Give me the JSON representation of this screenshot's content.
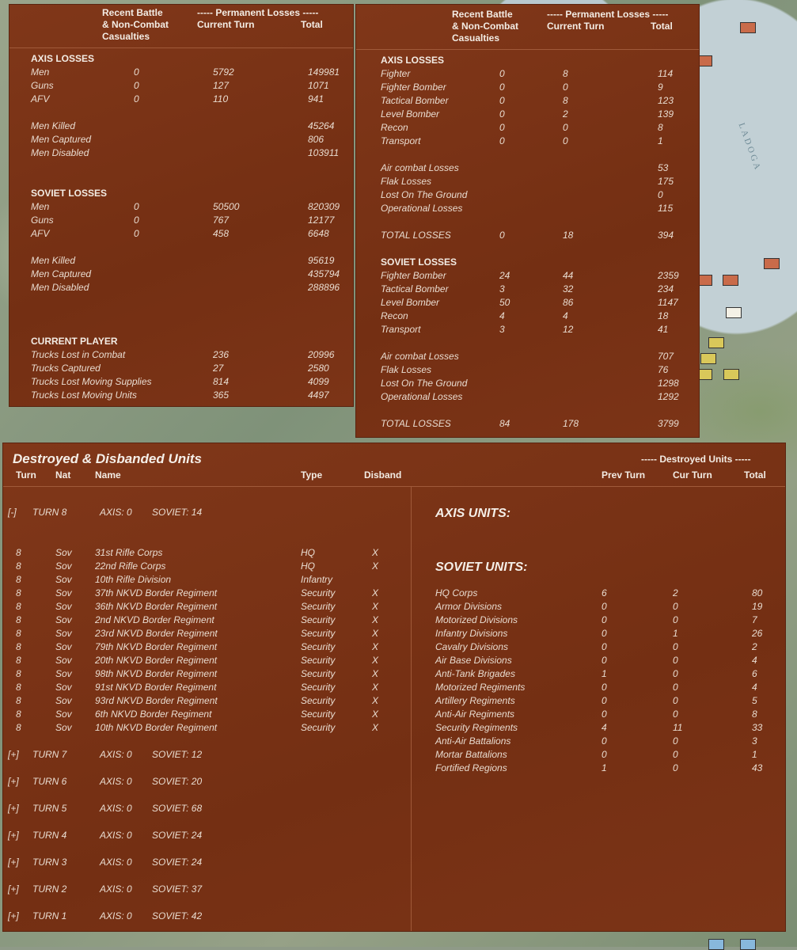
{
  "map": {
    "lake_label": "LADOGA"
  },
  "left_panel": {
    "header": {
      "recent": "Recent Battle\n& Non-Combat\nCasualties",
      "perm": "----- Permanent Losses -----",
      "current": "Current Turn",
      "total": "Total"
    },
    "sections": [
      {
        "title": "AXIS LOSSES",
        "rows": [
          [
            "Men",
            "0",
            "5792",
            "149981"
          ],
          [
            "Guns",
            "0",
            "127",
            "1071"
          ],
          [
            "AFV",
            "0",
            "110",
            "941"
          ]
        ],
        "rows2": [
          [
            "Men Killed",
            "",
            "",
            "45264"
          ],
          [
            "Men Captured",
            "",
            "",
            "806"
          ],
          [
            "Men Disabled",
            "",
            "",
            "103911"
          ]
        ]
      },
      {
        "title": "SOVIET LOSSES",
        "rows": [
          [
            "Men",
            "0",
            "50500",
            "820309"
          ],
          [
            "Guns",
            "0",
            "767",
            "12177"
          ],
          [
            "AFV",
            "0",
            "458",
            "6648"
          ]
        ],
        "rows2": [
          [
            "Men Killed",
            "",
            "",
            "95619"
          ],
          [
            "Men Captured",
            "",
            "",
            "435794"
          ],
          [
            "Men Disabled",
            "",
            "",
            "288896"
          ]
        ]
      },
      {
        "title": "CURRENT PLAYER",
        "rows": [
          [
            "Trucks Lost in Combat",
            "",
            "236",
            "20996"
          ],
          [
            "Trucks Captured",
            "",
            "27",
            "2580"
          ],
          [
            "Trucks Lost Moving Supplies",
            "",
            "814",
            "4099"
          ],
          [
            "Trucks Lost Moving Units",
            "",
            "365",
            "4497"
          ]
        ],
        "rows2": []
      }
    ]
  },
  "right_panel": {
    "header": {
      "recent": "Recent Battle\n& Non-Combat\nCasualties",
      "perm": "----- Permanent Losses -----",
      "current": "Current Turn",
      "total": "Total"
    },
    "axis_title": "AXIS LOSSES",
    "axis_rows": [
      [
        "Fighter",
        "0",
        "8",
        "114"
      ],
      [
        "Fighter Bomber",
        "0",
        "0",
        "9"
      ],
      [
        "Tactical Bomber",
        "0",
        "8",
        "123"
      ],
      [
        "Level Bomber",
        "0",
        "2",
        "139"
      ],
      [
        "Recon",
        "0",
        "0",
        "8"
      ],
      [
        "Transport",
        "0",
        "0",
        "1"
      ]
    ],
    "axis_rows2": [
      [
        "Air combat Losses",
        "",
        "",
        "53"
      ],
      [
        "Flak Losses",
        "",
        "",
        "175"
      ],
      [
        "Lost On The Ground",
        "",
        "",
        "0"
      ],
      [
        "Operational Losses",
        "",
        "",
        "115"
      ]
    ],
    "axis_total": [
      "TOTAL LOSSES",
      "0",
      "18",
      "394"
    ],
    "soviet_title": "SOVIET LOSSES",
    "soviet_rows": [
      [
        "Fighter Bomber",
        "24",
        "44",
        "2359"
      ],
      [
        "Tactical Bomber",
        "3",
        "32",
        "234"
      ],
      [
        "Level Bomber",
        "50",
        "86",
        "1147"
      ],
      [
        "Recon",
        "4",
        "4",
        "18"
      ],
      [
        "Transport",
        "3",
        "12",
        "41"
      ]
    ],
    "soviet_rows2": [
      [
        "Air combat Losses",
        "",
        "",
        "707"
      ],
      [
        "Flak Losses",
        "",
        "",
        "76"
      ],
      [
        "Lost On The Ground",
        "",
        "",
        "1298"
      ],
      [
        "Operational Losses",
        "",
        "",
        "1292"
      ]
    ],
    "soviet_total": [
      "TOTAL LOSSES",
      "84",
      "178",
      "3799"
    ]
  },
  "units_panel": {
    "title": "Destroyed & Disbanded Units",
    "destroyed_hdr": "----- Destroyed Units -----",
    "cols": {
      "turn": "Turn",
      "nat": "Nat",
      "name": "Name",
      "type": "Type",
      "disband": "Disband",
      "prev": "Prev Turn",
      "cur": "Cur Turn",
      "total": "Total"
    },
    "turn8": {
      "toggle": "[-]",
      "label": "TURN 8",
      "axis": "AXIS: 0",
      "soviet": "SOVIET: 14"
    },
    "units": [
      [
        "8",
        "Sov",
        "31st Rifle Corps",
        "HQ",
        "X"
      ],
      [
        "8",
        "Sov",
        "22nd Rifle Corps",
        "HQ",
        "X"
      ],
      [
        "8",
        "Sov",
        "10th Rifle Division",
        "Infantry",
        ""
      ],
      [
        "8",
        "Sov",
        "37th NKVD Border Regiment",
        "Security",
        "X"
      ],
      [
        "8",
        "Sov",
        "36th NKVD Border Regiment",
        "Security",
        "X"
      ],
      [
        "8",
        "Sov",
        "2nd NKVD Border Regiment",
        "Security",
        "X"
      ],
      [
        "8",
        "Sov",
        "23rd NKVD Border Regiment",
        "Security",
        "X"
      ],
      [
        "8",
        "Sov",
        "79th NKVD Border Regiment",
        "Security",
        "X"
      ],
      [
        "8",
        "Sov",
        "20th NKVD Border Regiment",
        "Security",
        "X"
      ],
      [
        "8",
        "Sov",
        "98th NKVD Border Regiment",
        "Security",
        "X"
      ],
      [
        "8",
        "Sov",
        "91st NKVD Border Regiment",
        "Security",
        "X"
      ],
      [
        "8",
        "Sov",
        "93rd NKVD Border Regiment",
        "Security",
        "X"
      ],
      [
        "8",
        "Sov",
        "6th NKVD Border Regiment",
        "Security",
        "X"
      ],
      [
        "8",
        "Sov",
        "10th NKVD Border Regiment",
        "Security",
        "X"
      ]
    ],
    "turns": [
      [
        "[+]",
        "TURN 7",
        "AXIS: 0",
        "SOVIET: 12"
      ],
      [
        "[+]",
        "TURN 6",
        "AXIS: 0",
        "SOVIET: 20"
      ],
      [
        "[+]",
        "TURN 5",
        "AXIS: 0",
        "SOVIET: 68"
      ],
      [
        "[+]",
        "TURN 4",
        "AXIS: 0",
        "SOVIET: 24"
      ],
      [
        "[+]",
        "TURN 3",
        "AXIS: 0",
        "SOVIET: 24"
      ],
      [
        "[+]",
        "TURN 2",
        "AXIS: 0",
        "SOVIET: 37"
      ],
      [
        "[+]",
        "TURN 1",
        "AXIS: 0",
        "SOVIET: 42"
      ]
    ],
    "axis_units_title": "AXIS UNITS:",
    "soviet_units_title": "SOVIET UNITS:",
    "soviet_units": [
      [
        "HQ Corps",
        "6",
        "2",
        "80"
      ],
      [
        "Armor Divisions",
        "0",
        "0",
        "19"
      ],
      [
        "Motorized Divisions",
        "0",
        "0",
        "7"
      ],
      [
        "Infantry Divisions",
        "0",
        "1",
        "26"
      ],
      [
        "Cavalry Divisions",
        "0",
        "0",
        "2"
      ],
      [
        "Air Base Divisions",
        "0",
        "0",
        "4"
      ],
      [
        "Anti-Tank Brigades",
        "1",
        "0",
        "6"
      ],
      [
        "Motorized Regiments",
        "0",
        "0",
        "4"
      ],
      [
        "Artillery Regiments",
        "0",
        "0",
        "5"
      ],
      [
        "Anti-Air Regiments",
        "0",
        "0",
        "8"
      ],
      [
        "Security Regiments",
        "4",
        "11",
        "33"
      ],
      [
        "Anti-Air Battalions",
        "0",
        "0",
        "3"
      ],
      [
        "Mortar Battalions",
        "0",
        "0",
        "1"
      ],
      [
        "Fortified Regions",
        "1",
        "0",
        "43"
      ]
    ]
  }
}
